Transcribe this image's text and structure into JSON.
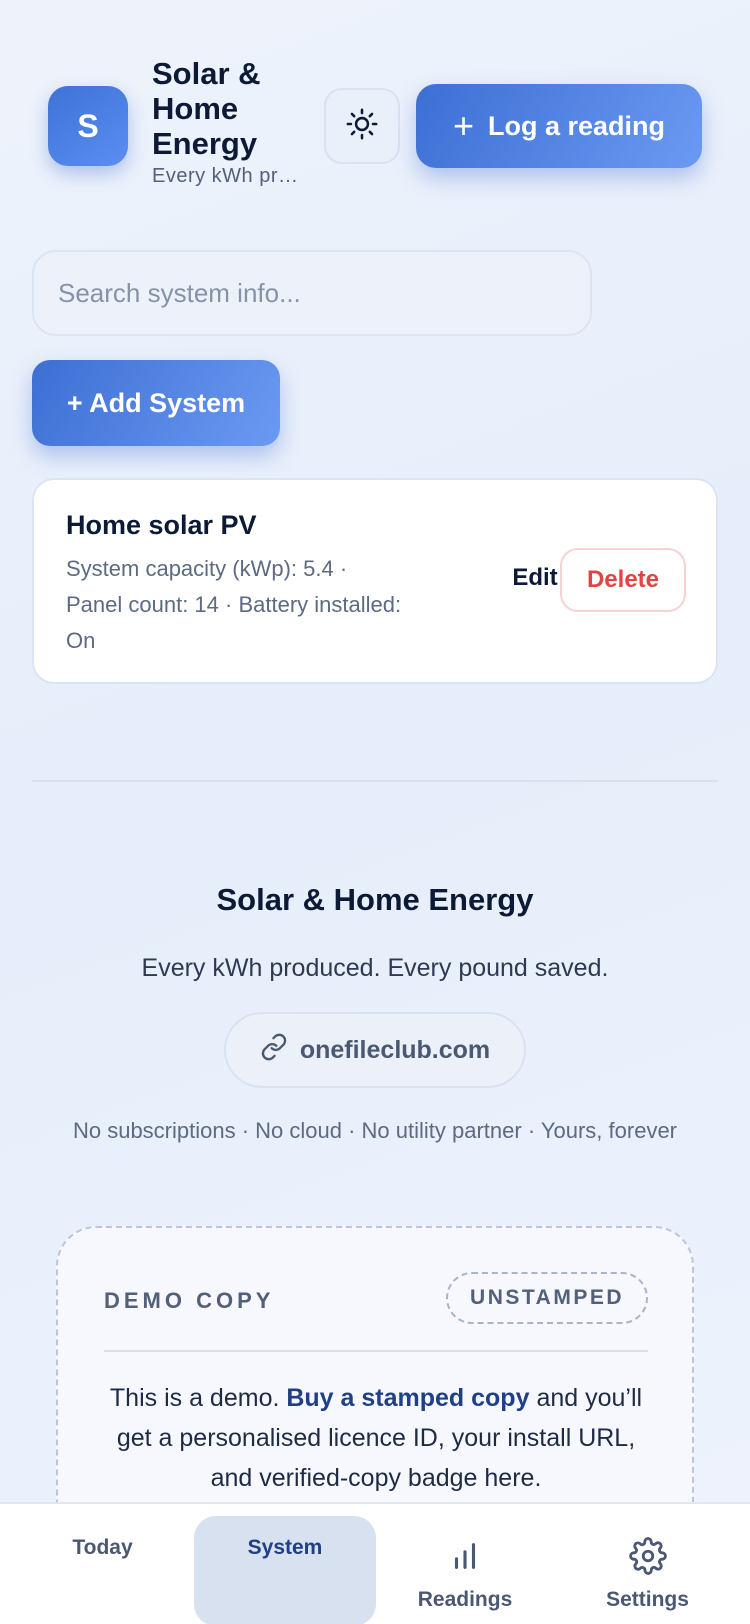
{
  "header": {
    "logo_letter": "S",
    "app_title": "Solar & Home Energy",
    "app_subtitle": "Every kWh produced. Every pound saved.",
    "theme_icon": "sun-icon",
    "log_button_label": "Log a reading"
  },
  "search": {
    "placeholder": "Search system info...",
    "value": ""
  },
  "add_system_label": "+ Add System",
  "systems": [
    {
      "name": "Home solar PV",
      "details": "System capacity (kWp): 5.4 · Panel count: 14 · Battery installed: On",
      "edit_label": "Edit",
      "delete_label": "Delete"
    }
  ],
  "footer": {
    "title": "Solar & Home Energy",
    "tagline": "Every kWh produced. Every pound saved.",
    "site": "onefileclub.com",
    "note": "No subscriptions · No cloud · No utility partner · Yours, forever"
  },
  "demo": {
    "label": "DEMO COPY",
    "badge": "UNSTAMPED",
    "text_prefix": "This is a demo. ",
    "text_link": "Buy a stamped copy",
    "text_suffix": " and you’ll get a personalised licence ID, your install URL, and verified-copy badge here."
  },
  "nav": {
    "today": "Today",
    "system": "System",
    "readings": "Readings",
    "settings": "Settings",
    "active": "System"
  },
  "colors": {
    "accent": "#3d6fd4",
    "accent_light": "#6a9af2",
    "danger": "#e24444",
    "text_dark": "#0d1a36"
  }
}
